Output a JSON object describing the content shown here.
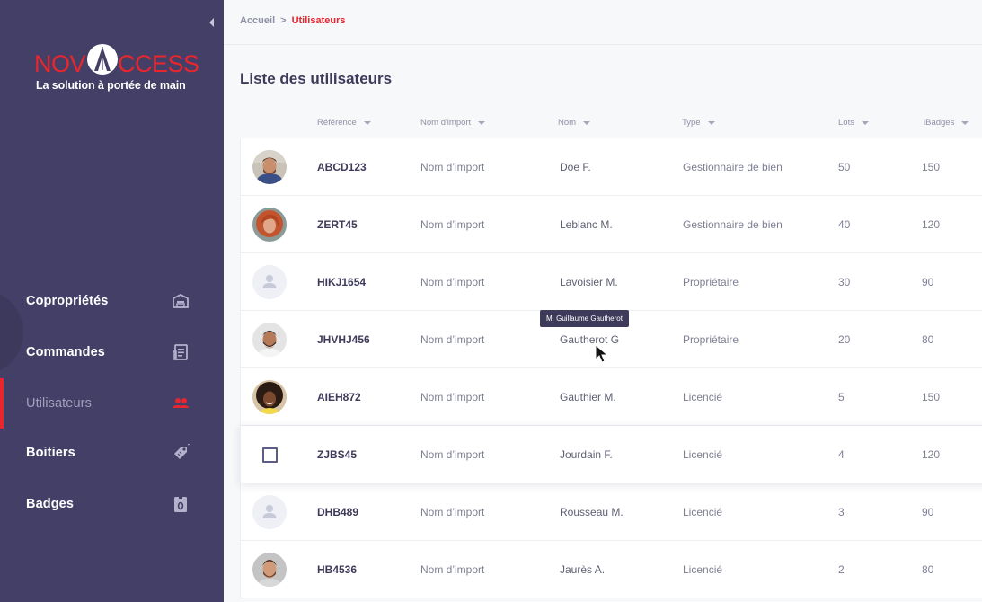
{
  "brand": {
    "logo_text_left": "NOV",
    "logo_text_right": "CCESS",
    "tagline": "La solution à portée de main",
    "accent_color": "#e8262d",
    "sidebar_color": "#433f66"
  },
  "sidebar": {
    "collapse_icon": "chevron-left-icon",
    "items": [
      {
        "label": "Copropriétés",
        "icon": "building-icon",
        "active": false
      },
      {
        "label": "Commandes",
        "icon": "receipt-icon",
        "active": false
      },
      {
        "label": "Utilisateurs",
        "icon": "users-icon",
        "active": true
      },
      {
        "label": "Boitiers",
        "icon": "tag-icon",
        "active": false
      },
      {
        "label": "Badges",
        "icon": "badge-icon",
        "active": false
      }
    ]
  },
  "breadcrumb": {
    "home": "Accueil",
    "separator": ">",
    "current": "Utilisateurs"
  },
  "page": {
    "title": "Liste des utilisateurs"
  },
  "table": {
    "columns": [
      "Référence",
      "Nom d'import",
      "Nom",
      "Type",
      "Lots",
      "iBadges"
    ],
    "rows": [
      {
        "ref": "ABCD123",
        "import": "Nom d’import",
        "name": "Doe F.",
        "type": "Gestionnaire de bien",
        "lots": "50",
        "ibadges": "150",
        "avatar": "photo-man-beard"
      },
      {
        "ref": "ZERT45",
        "import": "Nom d’import",
        "name": "Leblanc M.",
        "type": "Gestionnaire de bien",
        "lots": "40",
        "ibadges": "120",
        "avatar": "photo-woman-red-hair"
      },
      {
        "ref": "HIKJ1654",
        "import": "Nom d’import",
        "name": "Lavoisier M.",
        "type": "Propriétaire",
        "lots": "30",
        "ibadges": "90",
        "avatar": "placeholder"
      },
      {
        "ref": "JHVHJ456",
        "import": "Nom d’import",
        "name": "Gautherot G",
        "type": "Propriétaire",
        "lots": "20",
        "ibadges": "80",
        "avatar": "photo-man-smile"
      },
      {
        "ref": "AIEH872",
        "import": "Nom d’import",
        "name": "Gauthier M.",
        "type": "Licencié",
        "lots": "5",
        "ibadges": "150",
        "avatar": "photo-woman-curly"
      },
      {
        "ref": "ZJBS45",
        "import": "Nom d’import",
        "name": "Jourdain F.",
        "type": "Licencié",
        "lots": "4",
        "ibadges": "120",
        "avatar": "checkbox"
      },
      {
        "ref": "DHB489",
        "import": "Nom d’import",
        "name": "Rousseau M.",
        "type": "Licencié",
        "lots": "3",
        "ibadges": "90",
        "avatar": "placeholder"
      },
      {
        "ref": "HB4536",
        "import": "Nom d’import",
        "name": "Jaurès A.",
        "type": "Licencié",
        "lots": "2",
        "ibadges": "80",
        "avatar": "photo-man-beard-2"
      }
    ]
  },
  "tooltip": {
    "text": "M. Guillaume Gautherot"
  }
}
